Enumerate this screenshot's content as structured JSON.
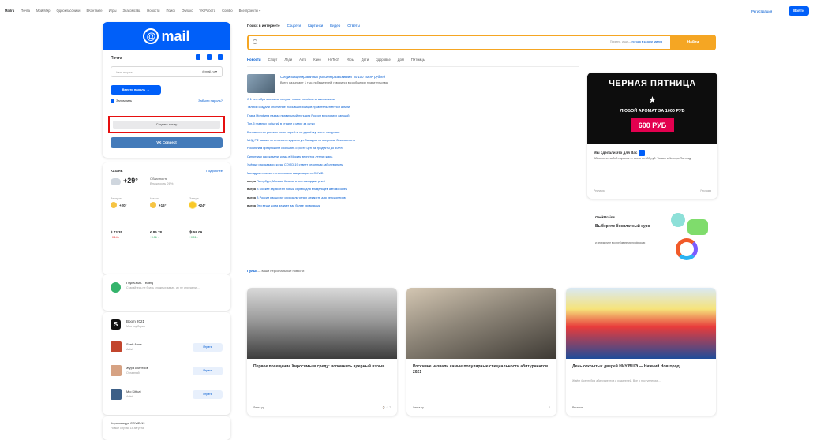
{
  "topnav": [
    "Mailru",
    "Почта",
    "Мой Мир",
    "Одноклассники",
    "ВКонтакте",
    "Игры",
    "Знакомства",
    "Новости",
    "Поиск",
    "Облако",
    "VK Работа",
    "Combo",
    "Все проекты ▾"
  ],
  "top_right": {
    "register": "Регистрация",
    "login": "Войти"
  },
  "mail": {
    "logo": "mail",
    "title": "Почта",
    "login_placeholder": "Имя ящика",
    "domain": "@mail.ru ▾",
    "enter_btn": "Ввести пароль →",
    "remember": "Запомнить",
    "forgot": "Забыли пароль?",
    "create": "Создать почту",
    "vk_btn": "VK Connect"
  },
  "weather": {
    "city": "Казань",
    "more": "Подробнее",
    "temp": "+29°",
    "desc": "Облачность",
    "desc_sub": "Влажность 26%",
    "forecast": [
      {
        "label": "Вечером",
        "temp": "+20°"
      },
      {
        "label": "Ночью",
        "temp": "+16°"
      },
      {
        "label": "Завтра",
        "temp": "+24°"
      }
    ],
    "rates": [
      {
        "label": "$ 73.35",
        "change": "−0.14 ↓",
        "dir": "red"
      },
      {
        "label": "€ 86.78",
        "change": "+0.06 ↑",
        "dir": "green"
      },
      {
        "label": "₿ 58.09",
        "change": "+0.01 ↑",
        "dir": "green"
      }
    ]
  },
  "horoscope": {
    "title": "Гороскоп: Телец",
    "text": "Старайтесь не брать сложных задач, их не определи ..."
  },
  "music": {
    "title": "Boom 2021",
    "sub": "Моя подборка",
    "listen": "Играть",
    "tracks": [
      {
        "name": "Seeb Anna",
        "artist": "Artist"
      },
      {
        "name": "Жура криптоов",
        "artist": "Оглавный"
      },
      {
        "name": "Mio Kittcat",
        "artist": "Artist"
      }
    ]
  },
  "covid": {
    "title": "Коронавирус COVID-19",
    "sub": "Новые случаи 18 августа"
  },
  "search": {
    "tabs": [
      "Поиск в интернете",
      "Соцсети",
      "Картинки",
      "Видео",
      "Ответы"
    ],
    "hint_prefix": "Пример, ищи —",
    "hint_link": "погода в казани завтра",
    "button": "Найти"
  },
  "news_tabs": [
    "Новости",
    "Спорт",
    "Леди",
    "Авто",
    "Кино",
    "Hi-Tech",
    "Игры",
    "Дети",
    "Здоровье",
    "Дом",
    "Питомцы"
  ],
  "lead": {
    "title": "Среди вакцинированных россиян разыскивают по 100 тысяч рублей",
    "sub": "Всего разыграют 1 тыс. победителей, говорится в сообщении правительства"
  },
  "news": [
    {
      "pre": "",
      "text": "С 1 сентября москвичи получат новые пособия на школьников"
    },
    {
      "pre": "",
      "text": "Талибы создали ополчение из бывших бойцов правительственной армии"
    },
    {
      "pre": "",
      "text": "Глава Минфина назвал правильный путь для России в условиях санкций"
    },
    {
      "pre": "",
      "text": "Топ-5 главных событий в стране и мире за сутки"
    },
    {
      "pre": "",
      "text": "Большинство россиян хотят перейти на удалёнку после пандемии"
    },
    {
      "pre": "",
      "text": "МИД РФ заявил о готовности к диалогу с Западом по вопросам безопасности"
    },
    {
      "pre": "",
      "text": "Россиянам предложили сообщать о росте цен на продукты до 300%"
    },
    {
      "pre": "",
      "text": "Синоптики рассказали, когда в Москву вернётся летняя жара"
    },
    {
      "pre": "",
      "text": "Учёные рассказали, когда COVID-19 станет сезонным заболеванием"
    },
    {
      "pre": "",
      "text": "Минздрав ответил на вопросы о вакцинации от COVID"
    },
    {
      "pre": "вчера",
      "text": "Петербург, Москва, Казань: итоги выходных дней"
    },
    {
      "pre": "вчера",
      "text": "В Москве заработал новый сервис для владельцев автомобилей"
    },
    {
      "pre": "вчера",
      "text": "В России расширят список льготных лекарств для пенсионеров"
    },
    {
      "pre": "вчера",
      "text": "Эти вещи дома делают вас более уязвимыми"
    }
  ],
  "pulse": {
    "label": "Пульс",
    "text": "— ваши персональные новости"
  },
  "ad": {
    "headline": "ЧЕРНАЯ ПЯТНИЦА",
    "offer": "ЛЮБОЙ АРОМАТ ЗА 1000 РУБ",
    "price": "600 РУБ",
    "title": "Мы сделали это для Вас",
    "text": "Абсолютно любой парфюм — всего за 600 руб. Только в Черную Пятницу",
    "source": "Реклама",
    "age": "Реклама"
  },
  "ad2": {
    "logo": "GeekBrains",
    "title": "Выберите бесплатный курс",
    "sub": "и определите востребованную профессию"
  },
  "cards": [
    {
      "title": "Первое посещение Хиросимы в среду: вспомнить ядерный взрыв",
      "sub": "",
      "src": "Лента.ру",
      "meta": "⌚ ☆ 7"
    },
    {
      "title": "Россияне назвали самые популярные специальности абитуриентов 2021",
      "sub": "",
      "src": "Лента.ру",
      "meta": "4"
    },
    {
      "title": "День открытых дверей НИУ ВШЭ — Нижний Новгород",
      "sub": "Ждём 4 сентября абитуриентов и родителей. Все о поступлении ...",
      "src": "Реклама",
      "meta": ""
    }
  ]
}
